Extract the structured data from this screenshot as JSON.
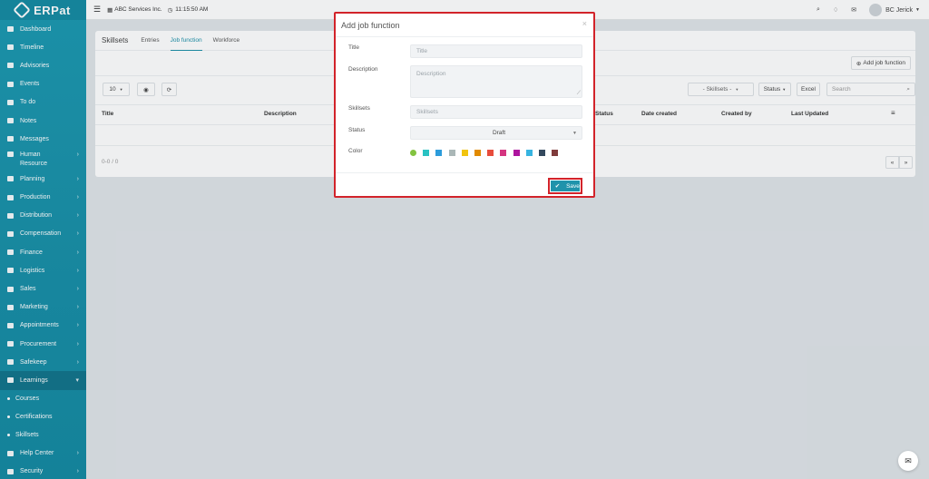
{
  "app": {
    "name": "ERPat"
  },
  "topbar": {
    "menu_icon": "menu-icon",
    "company": "ABC Services Inc.",
    "time": "11:15:50 AM",
    "user": "BC Jerick"
  },
  "sidebar": {
    "items": [
      {
        "label": "Dashboard",
        "icon": "dashboard-icon",
        "chevron": false
      },
      {
        "label": "Timeline",
        "icon": "timeline-icon",
        "chevron": false
      },
      {
        "label": "Advisories",
        "icon": "megaphone-icon",
        "chevron": false
      },
      {
        "label": "Events",
        "icon": "calendar-icon",
        "chevron": false
      },
      {
        "label": "To do",
        "icon": "checkbox-icon",
        "chevron": false
      },
      {
        "label": "Notes",
        "icon": "note-icon",
        "chevron": false
      },
      {
        "label": "Messages",
        "icon": "envelope-icon",
        "chevron": false
      },
      {
        "label": "Human Resource",
        "icon": "users-icon",
        "chevron": true
      },
      {
        "label": "Planning",
        "icon": "planning-icon",
        "chevron": true
      },
      {
        "label": "Production",
        "icon": "production-icon",
        "chevron": true
      },
      {
        "label": "Distribution",
        "icon": "bank-icon",
        "chevron": true
      },
      {
        "label": "Compensation",
        "icon": "money-icon",
        "chevron": true
      },
      {
        "label": "Finance",
        "icon": "finance-icon",
        "chevron": true
      },
      {
        "label": "Logistics",
        "icon": "truck-icon",
        "chevron": true
      },
      {
        "label": "Sales",
        "icon": "cart-icon",
        "chevron": true
      },
      {
        "label": "Marketing",
        "icon": "chart-icon",
        "chevron": true
      },
      {
        "label": "Appointments",
        "icon": "edit-icon",
        "chevron": true
      },
      {
        "label": "Procurement",
        "icon": "procurement-icon",
        "chevron": true
      },
      {
        "label": "Safekeep",
        "icon": "safe-icon",
        "chevron": true
      },
      {
        "label": "Learnings",
        "icon": "graduation-cap-icon",
        "chevron": true
      }
    ],
    "sub_items": [
      "Courses",
      "Certifications",
      "Skillsets"
    ],
    "bottom_items": [
      {
        "label": "Help Center",
        "icon": "help-icon"
      },
      {
        "label": "Security",
        "icon": "shield-icon"
      }
    ]
  },
  "page": {
    "title": "Skillsets",
    "tabs": [
      "Entries",
      "Job function",
      "Workforce"
    ],
    "active_tab": "Job function",
    "add_button": "Add job function",
    "page_size": "10",
    "filter_skillsets": "- Skillsets -",
    "filter_status": "Status",
    "excel_button": "Excel",
    "search_placeholder": "Search",
    "columns": [
      "Title",
      "Description",
      "Status",
      "Date created",
      "Created by",
      "Last Updated"
    ],
    "pagination": "0-0 / 0",
    "prev": "«",
    "next": "»"
  },
  "modal": {
    "title": "Add job function",
    "close": "×",
    "fields": {
      "title_label": "Title",
      "title_placeholder": "Title",
      "description_label": "Description",
      "description_placeholder": "Description",
      "skillsets_label": "Skillsets",
      "skillsets_placeholder": "Skillsets",
      "status_label": "Status",
      "status_value": "Draft",
      "color_label": "Color"
    },
    "colors": [
      "#83c340",
      "#29c2c2",
      "#2d9cdb",
      "#aab7b7",
      "#f1c40f",
      "#e18a00",
      "#e74c3c",
      "#d43480",
      "#ad159e",
      "#37b4e1",
      "#34495e",
      "#7f3b3b"
    ],
    "save_label": "Save"
  }
}
